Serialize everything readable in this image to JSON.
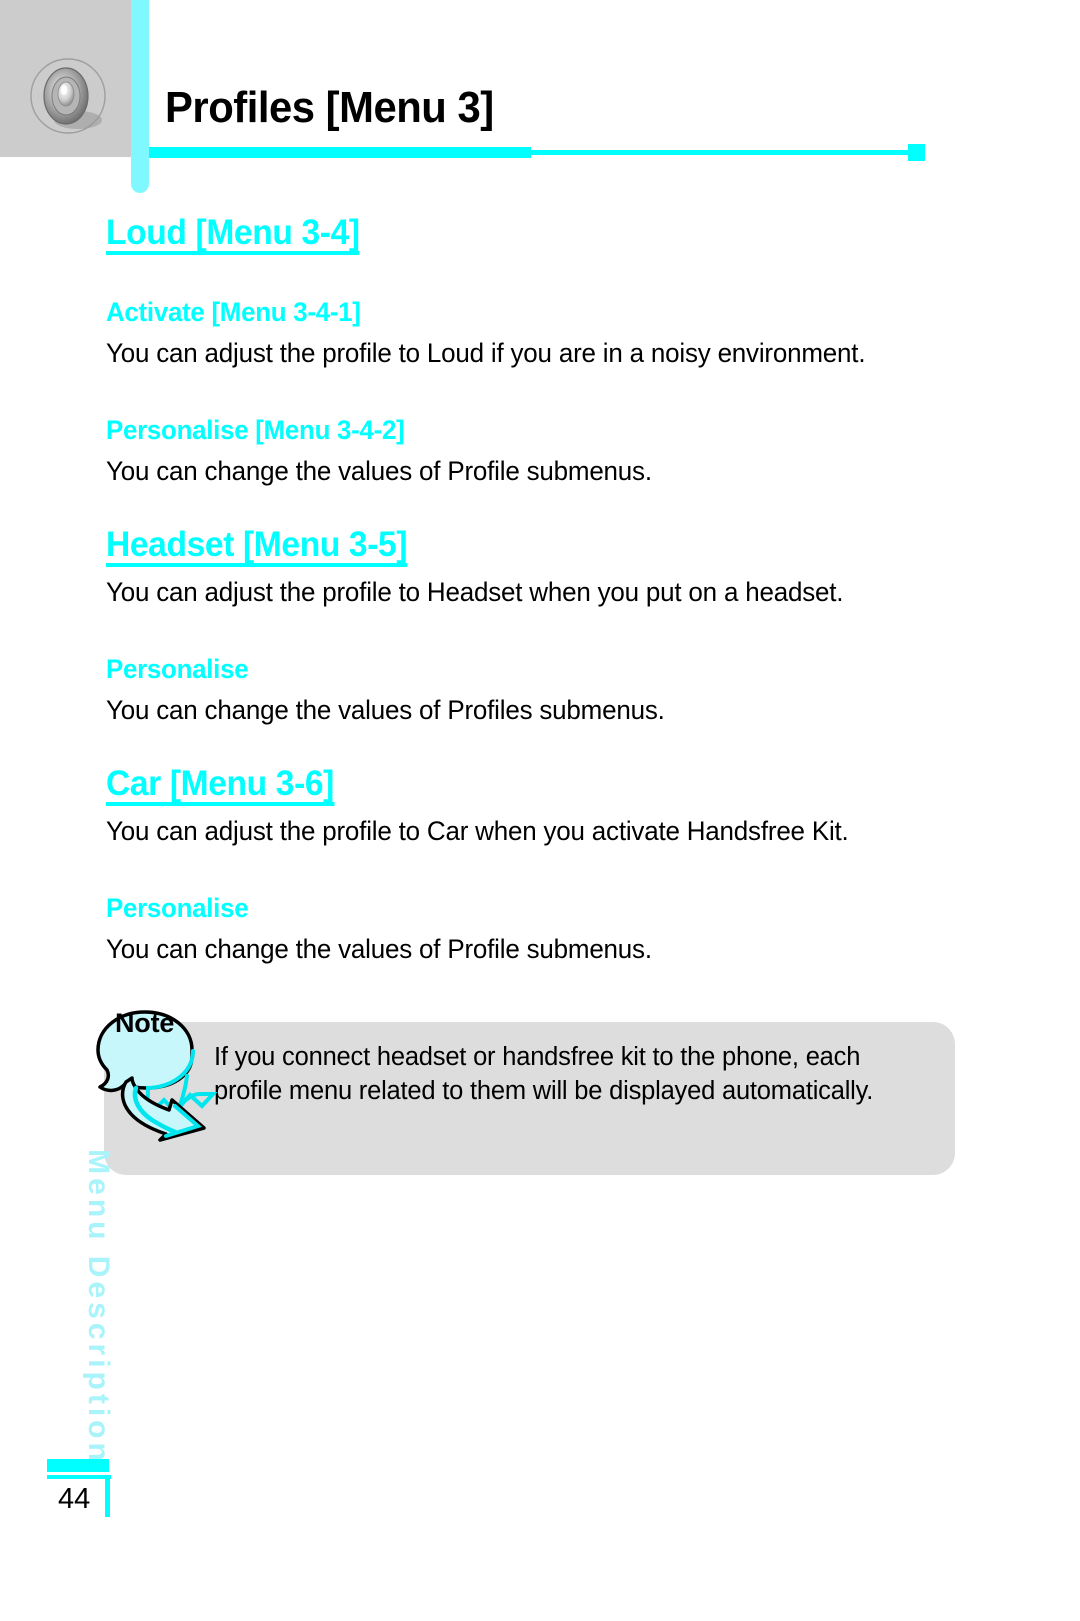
{
  "header": {
    "icon": "loudspeaker-icon",
    "title": "Profiles [Menu 3]",
    "accent_color": "#00ffff",
    "icon_block_color": "#cccccc"
  },
  "sections": [
    {
      "heading": "Loud [Menu 3-4]",
      "subsections": [
        {
          "subheading": "Activate [Menu 3-4-1]",
          "text": "You can adjust the profile to Loud if you are in a noisy environment."
        },
        {
          "subheading": "Personalise [Menu 3-4-2]",
          "text": "You can change the values of Profile submenus."
        }
      ]
    },
    {
      "heading": "Headset [Menu 3-5]",
      "intro": "You can adjust the profile to Headset when you put on a headset.",
      "subsections": [
        {
          "subheading": "Personalise",
          "text": "You can change the values of Profiles submenus."
        }
      ]
    },
    {
      "heading": "Car [Menu 3-6]",
      "intro": "You can adjust the profile to Car when you activate Handsfree Kit.",
      "subsections": [
        {
          "subheading": "Personalise",
          "text": "You can change the values of Profile submenus."
        }
      ]
    }
  ],
  "note": {
    "label": "Note",
    "text": "If you connect headset or handsfree kit to the phone, each profile menu related to them will be displayed automatically.",
    "box_color": "#dddddd",
    "callout_color": "#c8f7fb"
  },
  "side_tab": {
    "label": "Menu Description",
    "color": "#a9f3fb"
  },
  "footer": {
    "page_number": "44",
    "rule_color": "#00ffff"
  }
}
